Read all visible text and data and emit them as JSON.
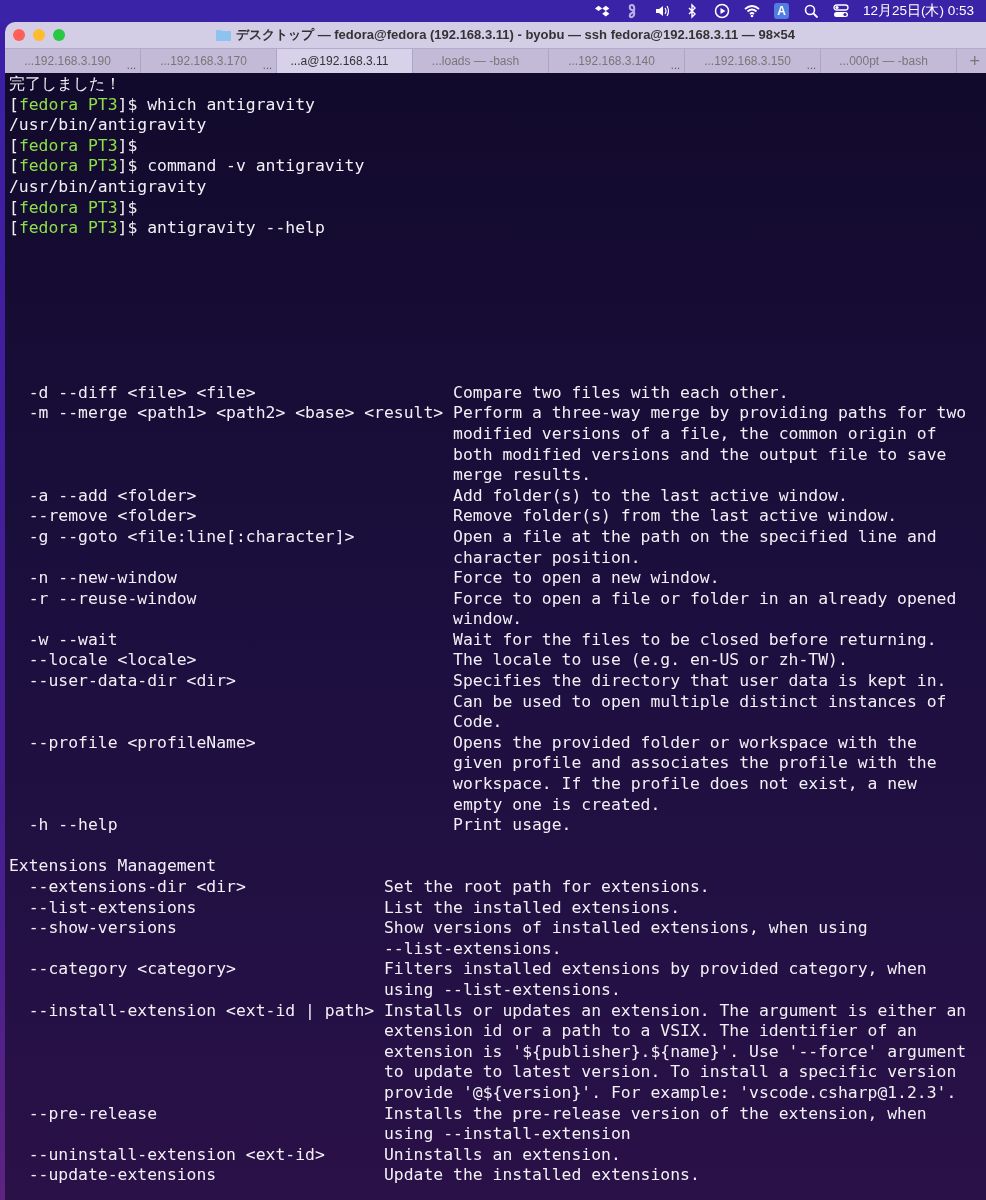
{
  "menu_bar": {
    "input_source": "A",
    "clock": "12月25日(木) 0:53"
  },
  "window": {
    "title": "デスクトップ — fedora@fedora (192.168.3.11) - byobu — ssh fedora@192.168.3.11 — 98×54"
  },
  "tabs": [
    {
      "label": "...192.168.3.190",
      "more": "...",
      "selected": false
    },
    {
      "label": "...192.168.3.170",
      "more": "...",
      "selected": false
    },
    {
      "label": "...a@192.168.3.11",
      "selected": true
    },
    {
      "label": "...loads — -bash",
      "selected": false
    },
    {
      "label": "...192.168.3.140",
      "more": "...",
      "selected": false
    },
    {
      "label": "...192.168.3.150",
      "more": "...",
      "selected": false
    },
    {
      "label": "...000pt — -bash",
      "selected": false
    }
  ],
  "new_tab": "+",
  "terminal": {
    "lines": [
      {
        "kind": "text",
        "text": "完了しました！"
      },
      {
        "kind": "prompt",
        "open": "[",
        "user": "fedora PT3",
        "close": "]$",
        "command": "which antigravity"
      },
      {
        "kind": "text",
        "text": "/usr/bin/antigravity"
      },
      {
        "kind": "prompt",
        "open": "[",
        "user": "fedora PT3",
        "close": "]$"
      },
      {
        "kind": "prompt",
        "open": "[",
        "user": "fedora PT3",
        "close": "]$",
        "command": "command -v antigravity"
      },
      {
        "kind": "text",
        "text": "/usr/bin/antigravity"
      },
      {
        "kind": "prompt",
        "open": "[",
        "user": "fedora PT3",
        "close": "]$"
      },
      {
        "kind": "prompt",
        "open": "[",
        "user": "fedora PT3",
        "close": "]$",
        "command": "antigravity --help"
      }
    ],
    "sections": [
      {
        "options": [
          {
            "option": "-d --diff <file> <file>",
            "lines": [
              "Compare two files with each other."
            ]
          },
          {
            "option": "-m --merge <path1> <path2> <base> <result>",
            "lines": [
              "Perform a three-way merge by providing paths for two",
              "modified versions of a file, the common origin of",
              "both modified versions and the output file to save",
              "merge results."
            ]
          },
          {
            "option": "-a --add <folder>",
            "lines": [
              "Add folder(s) to the last active window."
            ]
          },
          {
            "option": "--remove <folder>",
            "lines": [
              "Remove folder(s) from the last active window."
            ]
          },
          {
            "option": "-g --goto <file:line[:character]>",
            "lines": [
              "Open a file at the path on the specified line and",
              "character position."
            ]
          },
          {
            "option": "-n --new-window",
            "lines": [
              "Force to open a new window."
            ]
          },
          {
            "option": "-r --reuse-window",
            "lines": [
              "Force to open a file or folder in an already opened",
              "window."
            ]
          },
          {
            "option": "-w --wait",
            "lines": [
              "Wait for the files to be closed before returning."
            ]
          },
          {
            "option": "--locale <locale>",
            "lines": [
              "The locale to use (e.g. en-US or zh-TW)."
            ]
          },
          {
            "option": "--user-data-dir <dir>",
            "lines": [
              "Specifies the directory that user data is kept in.",
              "Can be used to open multiple distinct instances of",
              "Code."
            ]
          },
          {
            "option": "--profile <profileName>",
            "lines": [
              "Opens the provided folder or workspace with the",
              "given profile and associates the profile with the",
              "workspace. If the profile does not exist, a new",
              "empty one is created."
            ]
          },
          {
            "option": "-h --help",
            "lines": [
              "Print usage."
            ]
          }
        ]
      },
      {
        "heading": "Extensions Management",
        "options": [
          {
            "option": "--extensions-dir <dir>",
            "lines": [
              "Set the root path for extensions."
            ]
          },
          {
            "option": "--list-extensions",
            "lines": [
              "List the installed extensions."
            ]
          },
          {
            "option": "--show-versions",
            "lines": [
              "Show versions of installed extensions, when using",
              "--list-extensions."
            ]
          },
          {
            "option": "--category <category>",
            "lines": [
              "Filters installed extensions by provided category, when",
              "using --list-extensions."
            ]
          },
          {
            "option": "--install-extension <ext-id | path>",
            "lines": [
              "Installs or updates an extension. The argument is either an",
              "extension id or a path to a VSIX. The identifier of an",
              "extension is '${publisher}.${name}'. Use '--force' argument",
              "to update to latest version. To install a specific version",
              "provide '@${version}'. For example: 'vscode.csharp@1.2.3'."
            ]
          },
          {
            "option": "--pre-release",
            "lines": [
              "Installs the pre-release version of the extension, when",
              "using --install-extension"
            ]
          },
          {
            "option": "--uninstall-extension <ext-id>",
            "lines": [
              "Uninstalls an extension."
            ]
          },
          {
            "option": "--update-extensions",
            "lines": [
              "Update the installed extensions."
            ]
          }
        ]
      }
    ]
  }
}
